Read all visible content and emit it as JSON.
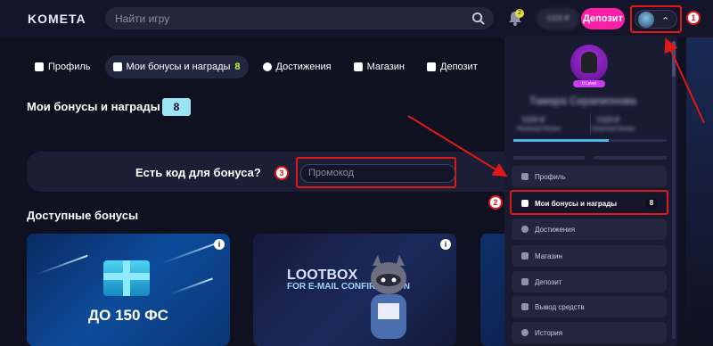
{
  "header": {
    "logo": "KOMETA",
    "search_placeholder": "Найти игру",
    "notification_count": "2",
    "balance": "5329 ₽",
    "deposit_label": "Депозит"
  },
  "nav": {
    "items": [
      {
        "label": "Профиль"
      },
      {
        "label": "Мои бонусы и награды",
        "count": "8",
        "active": true
      },
      {
        "label": "Достижения"
      },
      {
        "label": "Магазин"
      },
      {
        "label": "Депозит"
      }
    ]
  },
  "main": {
    "section_title": "Мои бонусы и награды",
    "section_count": "8",
    "code_label": "Есть код для бонуса?",
    "promo_placeholder": "Промокод",
    "available_title": "Доступные бонусы",
    "cards": [
      {
        "title": "ДО 150 ФС"
      },
      {
        "title": "LOOTBOX",
        "subtitle": "FOR E-MAIL CONFIRMATION"
      }
    ]
  },
  "dropdown": {
    "rank": "0 Level",
    "username": "Тамара Серапионова",
    "stat1_value": "5329 ₽",
    "stat1_label": "Реальный баланс",
    "stat2_value": "5329 ₽",
    "stat2_label": "Бонусный баланс",
    "menu": [
      {
        "label": "Профиль"
      },
      {
        "label": "Мои бонусы и награды",
        "count": "8",
        "active": true
      },
      {
        "label": "Достижения"
      },
      {
        "label": "Магазин"
      },
      {
        "label": "Депозит"
      },
      {
        "label": "Вывод средств"
      },
      {
        "label": "История"
      }
    ]
  },
  "callouts": {
    "c1": "1",
    "c2": "2",
    "c3": "3"
  },
  "colors": {
    "accent": "#ff1fa7",
    "highlight": "#e01818",
    "badge": "#9be4f6"
  }
}
